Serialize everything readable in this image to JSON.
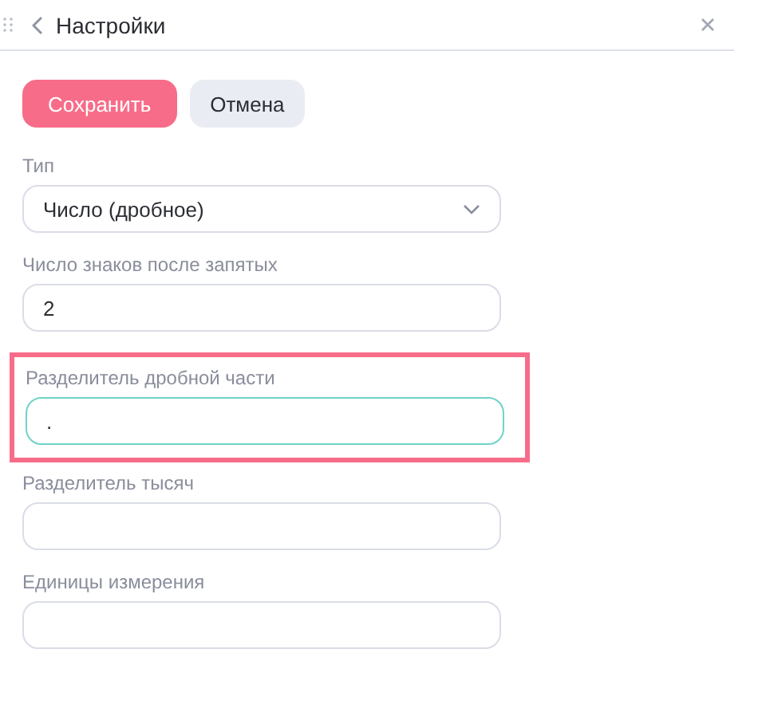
{
  "header": {
    "title": "Настройки"
  },
  "buttons": [
    {
      "label": "Сохранить",
      "kind": "primary"
    },
    {
      "label": "Отмена",
      "kind": "secondary"
    }
  ],
  "fields": [
    {
      "label": "Тип",
      "kind": "select",
      "value": "Число (дробное)",
      "highlighted": false,
      "focused": false
    },
    {
      "label": "Число знаков после запятых",
      "kind": "input",
      "value": "2",
      "highlighted": false,
      "focused": false
    },
    {
      "label": "Разделитель дробной части",
      "kind": "input",
      "value": ".",
      "highlighted": true,
      "focused": true
    },
    {
      "label": "Разделитель тысяч",
      "kind": "input",
      "highlighted": false,
      "focused": false
    },
    {
      "label": "Единицы измерения",
      "kind": "input",
      "highlighted": false,
      "focused": false
    }
  ]
}
